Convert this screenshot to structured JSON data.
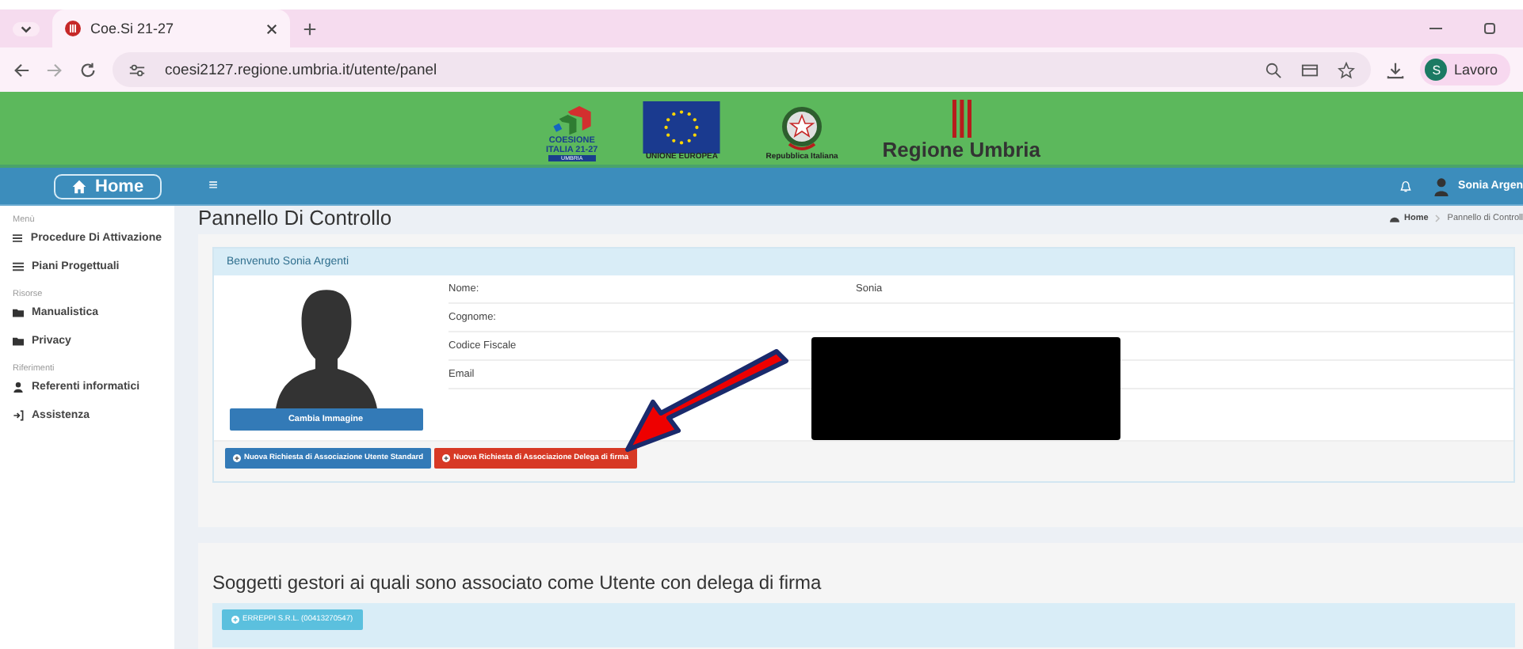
{
  "browser": {
    "tabs": [
      {
        "title": "Coe.Si 21-27",
        "selected": true
      }
    ],
    "url": "coesi2127.regione.umbria.it/utente/panel",
    "profile": {
      "initial": "S",
      "label": "Lavoro"
    }
  },
  "banner": {
    "logos": [
      {
        "kind": "coesione",
        "lines": [
          "COESIONE",
          "ITALIA 21-27"
        ],
        "sub": "UMBRIA"
      },
      {
        "kind": "eu",
        "lines": [
          "UNIONE EUROPEA"
        ]
      },
      {
        "kind": "emblem",
        "lines": [
          "Repubblica Italiana"
        ]
      }
    ],
    "title": "Regione Umbria"
  },
  "navbar": {
    "home": "Home",
    "menu_glyph": "≡",
    "user": "Sonia Argen"
  },
  "sidebar": [
    {
      "kind": "header",
      "label": "Menù"
    },
    {
      "kind": "list",
      "label": "Procedure Di Attivazione"
    },
    {
      "kind": "list",
      "label": "Piani Progettuali"
    },
    {
      "kind": "header",
      "label": "Risorse"
    },
    {
      "kind": "folder",
      "label": "Manualistica"
    },
    {
      "kind": "folder",
      "label": "Privacy"
    },
    {
      "kind": "header",
      "label": "Riferimenti"
    },
    {
      "kind": "user",
      "label": "Referenti informatici"
    },
    {
      "kind": "signin",
      "label": "Assistenza"
    }
  ],
  "page": {
    "title": "Pannello Di Controllo",
    "breadcrumb": [
      "Home",
      "Pannello di Controll"
    ]
  },
  "welcome": {
    "title": "Benvenuto Sonia Argenti",
    "change_image": "Cambia Immagine",
    "fields": [
      {
        "label": "Nome:",
        "value": "Sonia"
      },
      {
        "label": "Cognome:"
      },
      {
        "label": "Codice Fiscale"
      },
      {
        "label": "Email"
      }
    ],
    "actions": [
      {
        "kind": "primary",
        "label": "Nuova Richiesta di Associazione Utente Standard"
      },
      {
        "kind": "danger",
        "label": "Nuova Richiesta di Associazione Delega di firma"
      }
    ]
  },
  "delegations": {
    "title": "Soggetti gestori ai quali sono associato come Utente con delega di firma",
    "items": [
      "ERREPPI S.R.L. (00413270547)"
    ]
  }
}
